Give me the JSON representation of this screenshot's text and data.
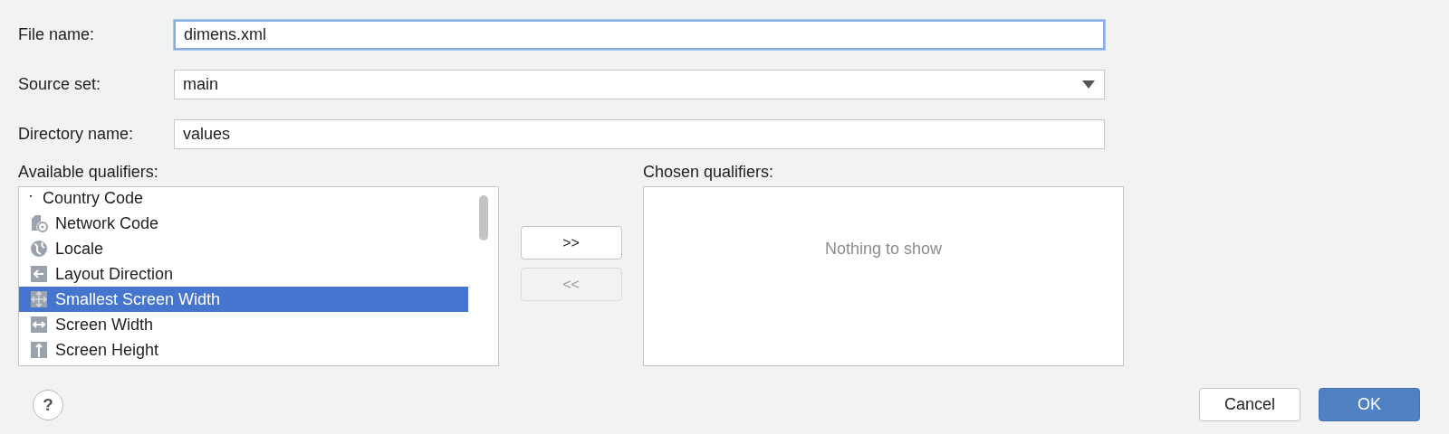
{
  "fields": [
    {
      "label": "File name:",
      "kind": "text",
      "value": "dimens.xml",
      "focused": true
    },
    {
      "label": "Source set:",
      "kind": "dropdown",
      "value": "main",
      "focused": false
    },
    {
      "label": "Directory name:",
      "kind": "text",
      "value": "values",
      "focused": false
    }
  ],
  "available": {
    "label": "Available qualifiers:",
    "items": [
      {
        "name": "Country Code",
        "kind": "dot",
        "selected": false
      },
      {
        "name": "Network Code",
        "kind": "network",
        "selected": false
      },
      {
        "name": "Locale",
        "kind": "globe",
        "selected": false
      },
      {
        "name": "Layout Direction",
        "kind": "left",
        "selected": false
      },
      {
        "name": "Smallest Screen Width",
        "kind": "expand",
        "selected": true
      },
      {
        "name": "Screen Width",
        "kind": "width",
        "selected": false
      },
      {
        "name": "Screen Height",
        "kind": "height",
        "selected": false
      }
    ]
  },
  "move_buttons": [
    {
      "label": ">>",
      "disabled": false
    },
    {
      "label": "<<",
      "disabled": true
    }
  ],
  "chosen": {
    "label": "Chosen qualifiers:",
    "empty_text": "Nothing to show"
  },
  "help": "?",
  "buttons": [
    {
      "label": "Cancel",
      "primary": false
    },
    {
      "label": "OK",
      "primary": true
    }
  ]
}
